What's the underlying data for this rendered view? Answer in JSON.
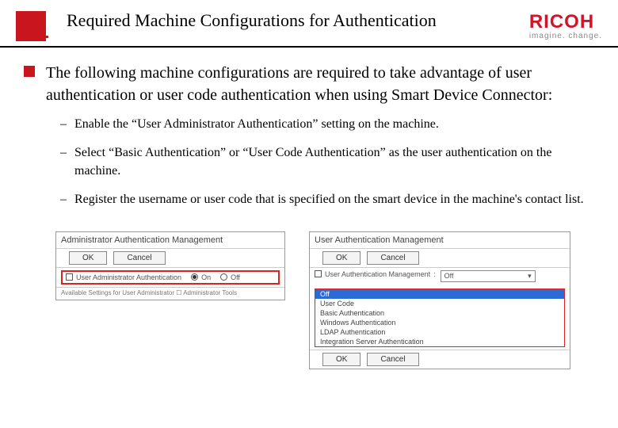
{
  "header": {
    "title": "Required Machine Configurations for Authentication",
    "brand": "RICOH",
    "tagline": "imagine. change."
  },
  "body": {
    "main_text": "The following machine configurations are required to take advantage of user authentication or user code authentication when using Smart Device Connector:",
    "sub_items": [
      "Enable the “User Administrator Authentication” setting on the machine.",
      "Select “Basic Authentication” or “User Code Authentication” as the user authentication on the machine.",
      "Register the username or user code that is specified on the smart device in the machine's contact list."
    ]
  },
  "panel1": {
    "title": "Administrator Authentication Management",
    "ok": "OK",
    "cancel": "Cancel",
    "row_label": "User Administrator Authentication",
    "radio_on": "On",
    "radio_off": "Off",
    "footer": "Available Settings for User Administrator   ☐ Administrator Tools"
  },
  "panel2": {
    "title": "User Authentication Management",
    "ok": "OK",
    "cancel": "Cancel",
    "row_label": "User Authentication Management",
    "select_value": "Off",
    "options": [
      "Off",
      "User Code",
      "Basic Authentication",
      "Windows Authentication",
      "LDAP Authentication",
      "Integration Server Authentication"
    ],
    "highlight_index": 0
  }
}
